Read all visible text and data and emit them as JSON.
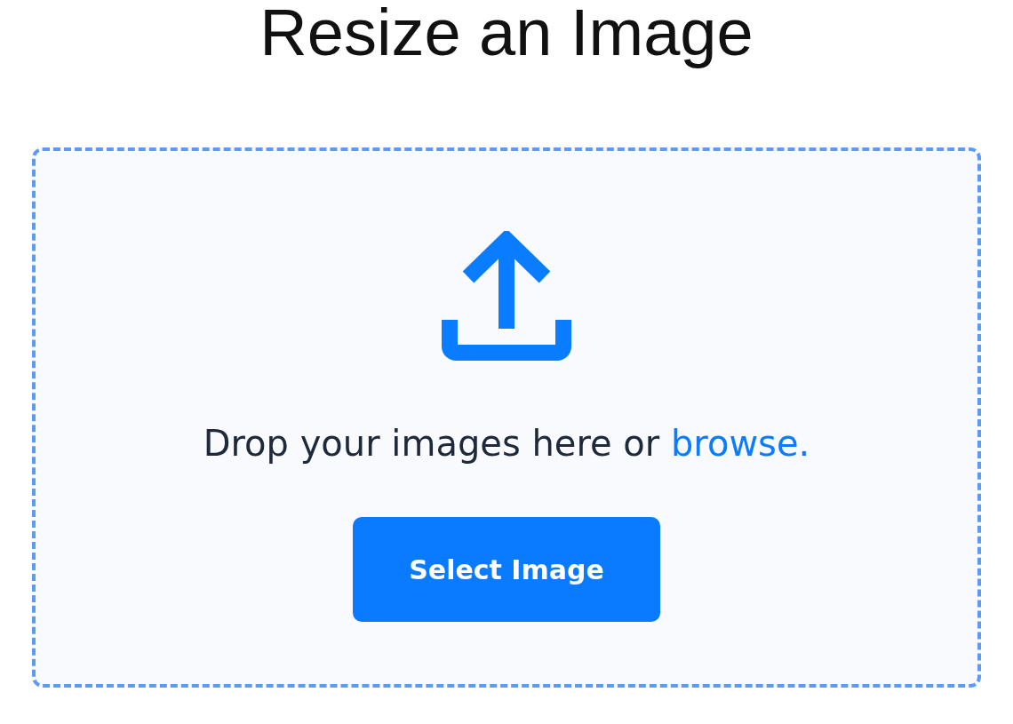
{
  "title": "Resize an Image",
  "dropzone": {
    "text": "Drop your images here or",
    "link": "browse.",
    "button": "Select Image"
  }
}
